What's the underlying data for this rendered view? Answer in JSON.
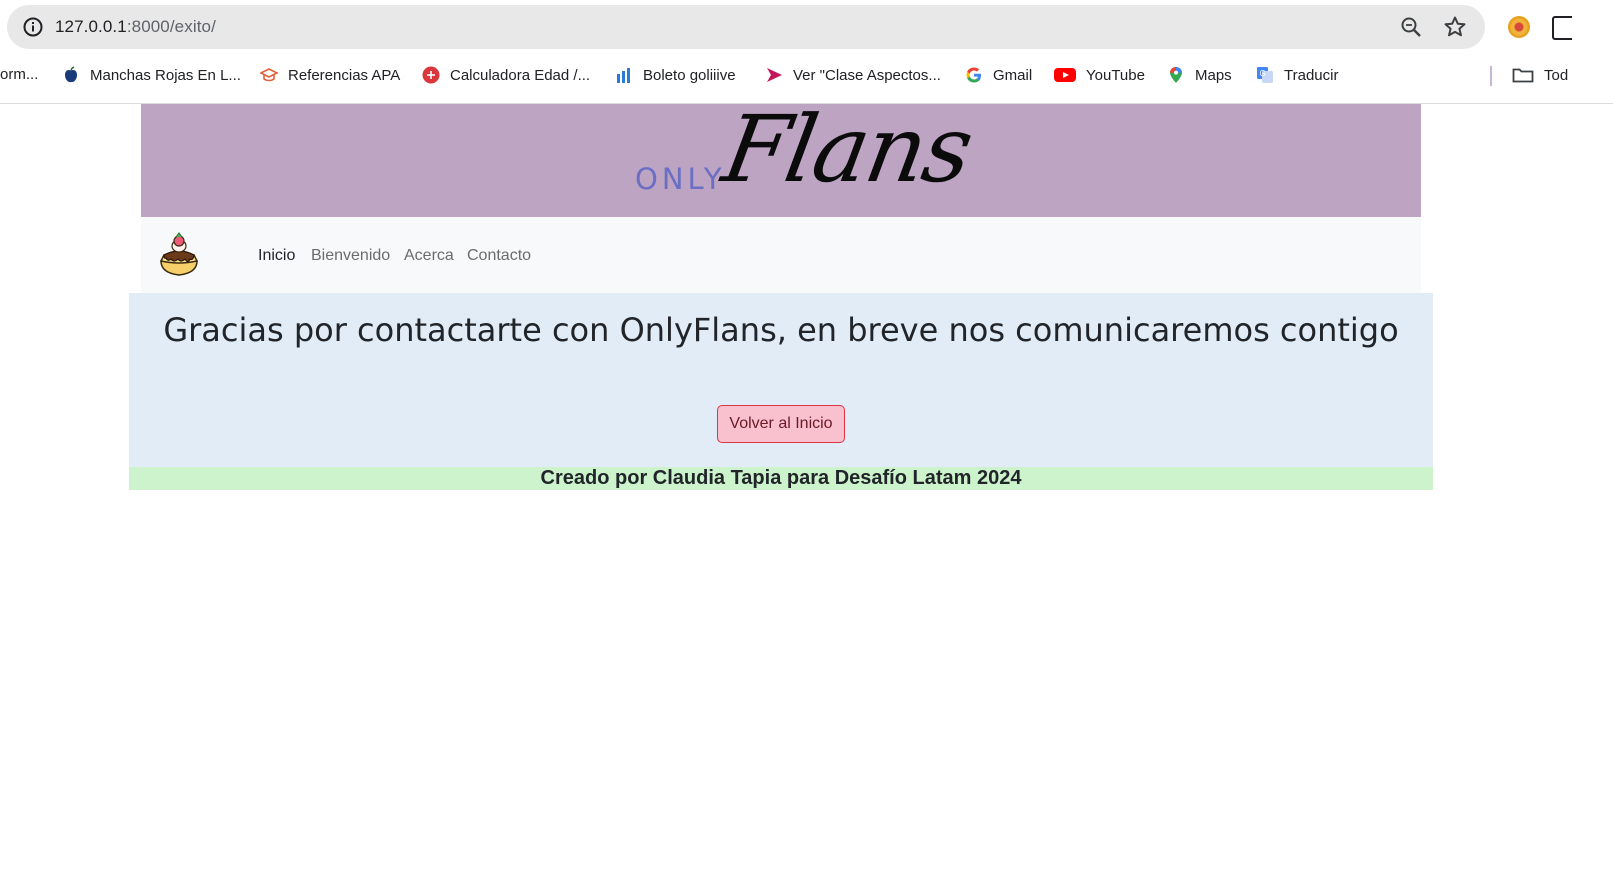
{
  "browser": {
    "url_host": "127.0.0.1",
    "url_path": ":8000/exito/",
    "bookmarks": [
      {
        "label": "orm...",
        "icon": "none"
      },
      {
        "label": "Manchas Rojas En L...",
        "icon": "apple-icon"
      },
      {
        "label": "Referencias APA",
        "icon": "cap-icon"
      },
      {
        "label": "Calculadora Edad /...",
        "icon": "calculator-icon"
      },
      {
        "label": "Boleto goliiive",
        "icon": "bars-icon"
      },
      {
        "label": "Ver \"Clase Aspectos...",
        "icon": "play-icon"
      },
      {
        "label": "Gmail",
        "icon": "google-icon"
      },
      {
        "label": "YouTube",
        "icon": "youtube-icon"
      },
      {
        "label": "Maps",
        "icon": "maps-icon"
      },
      {
        "label": "Traducir",
        "icon": "translate-icon"
      },
      {
        "label": "Tod",
        "icon": "folder-icon"
      }
    ]
  },
  "header": {
    "logo_small": "ONLY",
    "logo_large": "Flans"
  },
  "nav": {
    "items": [
      {
        "label": "Inicio",
        "active": true
      },
      {
        "label": "Bienvenido",
        "active": false
      },
      {
        "label": "Acerca",
        "active": false
      },
      {
        "label": "Contacto",
        "active": false
      }
    ]
  },
  "main": {
    "message": "Gracias por contactarte con OnlyFlans, en breve nos comunicaremos contigo",
    "button_label": "Volver al Inicio"
  },
  "footer": {
    "text": "Creado por Claudia Tapia para Desafío Latam 2024"
  },
  "colors": {
    "header_bg": "#bca4c2",
    "main_bg": "#e1ecf7",
    "footer_bg": "#cdf3cd",
    "button_bg": "#f9c0cd",
    "button_border": "#dc3545"
  }
}
